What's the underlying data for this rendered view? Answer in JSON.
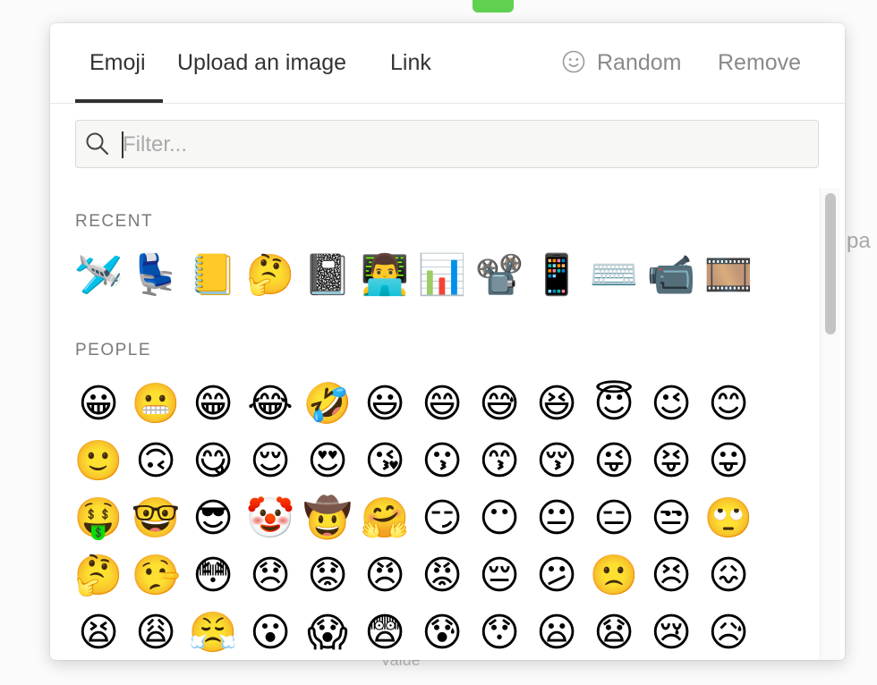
{
  "background": {
    "side_text": "pa",
    "bottom_text": "Value"
  },
  "tabs": [
    {
      "label": "Emoji",
      "active": true
    },
    {
      "label": "Upload an image"
    },
    {
      "label": "Link"
    }
  ],
  "actions": {
    "random_label": "Random",
    "random_icon": "smiley-icon",
    "remove_label": "Remove"
  },
  "search": {
    "placeholder": "Filter...",
    "value": ""
  },
  "sections": [
    {
      "title": "RECENT",
      "rows": [
        [
          "🛩️",
          "💺",
          "📒",
          "🤔",
          "📓",
          "👨‍💻",
          "📊",
          "📽️",
          "📱",
          "⌨️",
          "📹",
          "🎞️"
        ]
      ]
    },
    {
      "title": "PEOPLE",
      "rows": [
        [
          "😀",
          "😬",
          "😁",
          "😂",
          "🤣",
          "😃",
          "😄",
          "😅",
          "😆",
          "😇",
          "😉",
          "😊"
        ],
        [
          "🙂",
          "🙃",
          "😋",
          "😌",
          "😍",
          "😘",
          "😗",
          "😙",
          "😚",
          "😜",
          "😝",
          "😛"
        ],
        [
          "🤑",
          "🤓",
          "😎",
          "🤡",
          "🤠",
          "🤗",
          "😏",
          "😶",
          "😐",
          "😑",
          "😒",
          "🙄"
        ],
        [
          "🤔",
          "🤥",
          "😳",
          "😞",
          "😟",
          "😠",
          "😡",
          "😔",
          "😕",
          "🙁",
          "😣",
          "😖"
        ],
        [
          "😫",
          "😩",
          "😤",
          "😮",
          "😱",
          "😨",
          "😰",
          "😯",
          "😦",
          "😧",
          "😢",
          "😥"
        ]
      ]
    }
  ],
  "colors": {
    "active_tab_underline": "#2f2f2f",
    "muted_text": "#8a8a8a"
  }
}
